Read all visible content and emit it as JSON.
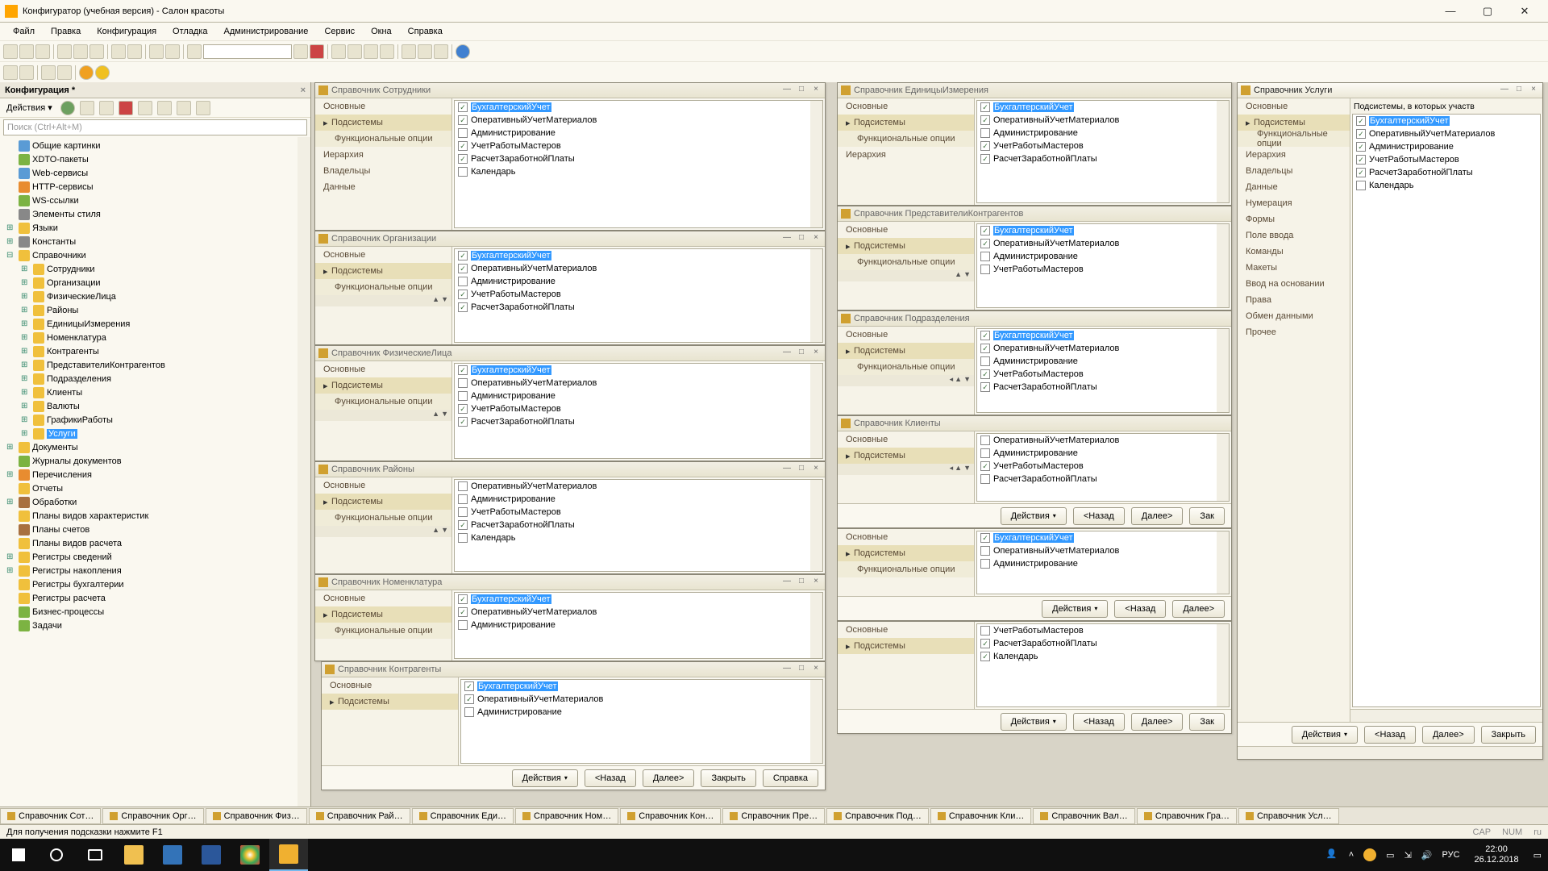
{
  "titlebar": {
    "text": "Конфигуратор (учебная версия) - Салон красоты"
  },
  "menu": [
    "Файл",
    "Правка",
    "Конфигурация",
    "Отладка",
    "Администрирование",
    "Сервис",
    "Окна",
    "Справка"
  ],
  "config_panel": {
    "title": "Конфигурация *",
    "actions": "Действия ▾",
    "search_placeholder": "Поиск (Ctrl+Alt+M)",
    "tree": [
      {
        "l": 0,
        "ico": "blue",
        "label": "Общие картинки"
      },
      {
        "l": 0,
        "ico": "green",
        "label": "XDTO-пакеты"
      },
      {
        "l": 0,
        "ico": "blue",
        "label": "Web-сервисы"
      },
      {
        "l": 0,
        "ico": "orange",
        "label": "HTTP-сервисы"
      },
      {
        "l": 0,
        "ico": "green",
        "label": "WS-ссылки"
      },
      {
        "l": 0,
        "ico": "gray",
        "label": "Элементы стиля"
      },
      {
        "l": 0,
        "exp": "⊞",
        "ico": "yellow",
        "label": "Языки"
      },
      {
        "l": 0,
        "exp": "⊞",
        "ico": "gray",
        "label": "Константы"
      },
      {
        "l": 0,
        "exp": "⊟",
        "ico": "yellow",
        "label": "Справочники"
      },
      {
        "l": 1,
        "exp": "⊞",
        "ico": "yellow",
        "label": "Сотрудники"
      },
      {
        "l": 1,
        "exp": "⊞",
        "ico": "yellow",
        "label": "Организации"
      },
      {
        "l": 1,
        "exp": "⊞",
        "ico": "yellow",
        "label": "ФизическиеЛица"
      },
      {
        "l": 1,
        "exp": "⊞",
        "ico": "yellow",
        "label": "Районы"
      },
      {
        "l": 1,
        "exp": "⊞",
        "ico": "yellow",
        "label": "ЕдиницыИзмерения"
      },
      {
        "l": 1,
        "exp": "⊞",
        "ico": "yellow",
        "label": "Номенклатура"
      },
      {
        "l": 1,
        "exp": "⊞",
        "ico": "yellow",
        "label": "Контрагенты"
      },
      {
        "l": 1,
        "exp": "⊞",
        "ico": "yellow",
        "label": "ПредставителиКонтрагентов"
      },
      {
        "l": 1,
        "exp": "⊞",
        "ico": "yellow",
        "label": "Подразделения"
      },
      {
        "l": 1,
        "exp": "⊞",
        "ico": "yellow",
        "label": "Клиенты"
      },
      {
        "l": 1,
        "exp": "⊞",
        "ico": "yellow",
        "label": "Валюты"
      },
      {
        "l": 1,
        "exp": "⊞",
        "ico": "yellow",
        "label": "ГрафикиРаботы"
      },
      {
        "l": 1,
        "exp": "⊞",
        "ico": "yellow",
        "label": "Услуги",
        "selected": true
      },
      {
        "l": 0,
        "exp": "⊞",
        "ico": "yellow",
        "label": "Документы"
      },
      {
        "l": 0,
        "ico": "green",
        "label": "Журналы документов"
      },
      {
        "l": 0,
        "exp": "⊞",
        "ico": "orange",
        "label": "Перечисления"
      },
      {
        "l": 0,
        "ico": "yellow",
        "label": "Отчеты"
      },
      {
        "l": 0,
        "exp": "⊞",
        "ico": "brown",
        "label": "Обработки"
      },
      {
        "l": 0,
        "ico": "yellow",
        "label": "Планы видов характеристик"
      },
      {
        "l": 0,
        "ico": "brown",
        "label": "Планы счетов"
      },
      {
        "l": 0,
        "ico": "yellow",
        "label": "Планы видов расчета"
      },
      {
        "l": 0,
        "exp": "⊞",
        "ico": "yellow",
        "label": "Регистры сведений"
      },
      {
        "l": 0,
        "exp": "⊞",
        "ico": "yellow",
        "label": "Регистры накопления"
      },
      {
        "l": 0,
        "ico": "yellow",
        "label": "Регистры бухгалтерии"
      },
      {
        "l": 0,
        "ico": "yellow",
        "label": "Регистры расчета"
      },
      {
        "l": 0,
        "ico": "green",
        "label": "Бизнес-процессы"
      },
      {
        "l": 0,
        "ico": "green",
        "label": "Задачи"
      }
    ]
  },
  "nav_common": {
    "osnovnye": "Основные",
    "podsistemy": "Подсистемы",
    "funkopt": "Функциональные опции",
    "ierarhiya": "Иерархия",
    "vladelcy": "Владельцы",
    "dannye": "Данные",
    "numeracia": "Нумерация",
    "formy": "Формы",
    "polevvoda": "Поле ввода",
    "komandy": "Команды",
    "makety": "Макеты",
    "vvod": "Ввод на основании",
    "prava": "Права",
    "obmen": "Обмен данными",
    "prochee": "Прочее"
  },
  "subs_header": "Подсистемы, в которых участв",
  "checks": {
    "buh": "БухгалтерскийУчет",
    "oper": "ОперативныйУчетМатериалов",
    "admin": "Администрирование",
    "uchet": "УчетРаботыМастеров",
    "raschet": "РасчетЗаработнойПлаты",
    "kalendar": "Календарь"
  },
  "btns": {
    "actions": "Действия",
    "back": "<Назад",
    "next": "Далее>",
    "close": "Закрыть",
    "help": "Справка",
    "zak": "Зак"
  },
  "windows": {
    "sotrudniki": "Справочник Сотрудники",
    "organizacii": "Справочник Организации",
    "fizlica": "Справочник ФизическиеЛица",
    "rayony": "Справочник Районы",
    "nomenklatura": "Справочник Номенклатура",
    "kontragenty": "Справочник Контрагенты",
    "edizm": "Справочник ЕдиницыИзмерения",
    "predstav": "Справочник ПредставителиКонтрагентов",
    "podrazd": "Справочник Подразделения",
    "klienty": "Справочник Клиенты",
    "uslugi": "Справочник Услуги"
  },
  "wintabs": [
    "Справочник Сот…",
    "Справочник Орг…",
    "Справочник Физ…",
    "Справочник Рай…",
    "Справочник Еди…",
    "Справочник Ном…",
    "Справочник Кон…",
    "Справочник Пре…",
    "Справочник Под…",
    "Справочник Кли…",
    "Справочник Вал…",
    "Справочник Гра…",
    "Справочник Усл…"
  ],
  "status": {
    "hint": "Для получения подсказки нажмите F1",
    "cap": "CAP",
    "num": "NUM",
    "ru": "ru"
  },
  "taskbar": {
    "lang": "РУС",
    "time": "22:00",
    "date": "26.12.2018"
  }
}
